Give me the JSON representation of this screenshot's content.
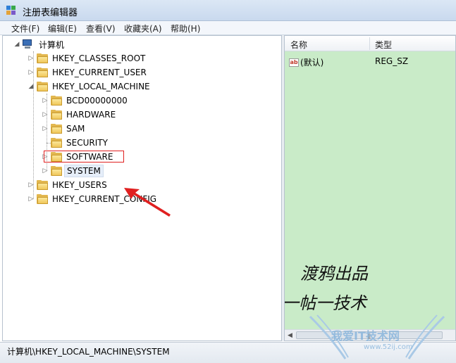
{
  "window": {
    "title": "注册表编辑器"
  },
  "menu": [
    "文件(F)",
    "编辑(E)",
    "查看(V)",
    "收藏夹(A)",
    "帮助(H)"
  ],
  "tree": {
    "root": "计算机",
    "hives": [
      {
        "label": "HKEY_CLASSES_ROOT"
      },
      {
        "label": "HKEY_CURRENT_USER"
      },
      {
        "label": "HKEY_LOCAL_MACHINE"
      },
      {
        "label": "HKEY_USERS"
      },
      {
        "label": "HKEY_CURRENT_CONFIG"
      }
    ],
    "hklm_children": [
      {
        "label": "BCD00000000"
      },
      {
        "label": "HARDWARE"
      },
      {
        "label": "SAM"
      },
      {
        "label": "SECURITY"
      },
      {
        "label": "SOFTWARE"
      },
      {
        "label": "SYSTEM"
      }
    ]
  },
  "list": {
    "columns": [
      "名称",
      "类型"
    ],
    "rows": [
      {
        "name": "(默认)",
        "type": "REG_SZ",
        "icon": "ab-string-icon"
      }
    ]
  },
  "annotation": {
    "line1": "渡鸦出品",
    "line2": "一帖一技术"
  },
  "watermark": {
    "text": "我爱IT技术网",
    "url": "www.52ij.com"
  },
  "status": {
    "path": "计算机\\HKEY_LOCAL_MACHINE\\SYSTEM"
  },
  "colors": {
    "list_bg": "#c9ebc8",
    "highlight_box": "#e02020",
    "arrow": "#e02020"
  }
}
